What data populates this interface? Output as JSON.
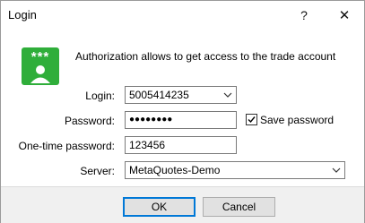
{
  "window": {
    "title": "Login",
    "help_glyph": "?",
    "close_glyph": "✕"
  },
  "header": {
    "icon_stars": "***",
    "message": "Authorization allows to get access to the trade account"
  },
  "form": {
    "login_label": "Login:",
    "login_value": "5005414235",
    "password_label": "Password:",
    "password_value": "●●●●●●●●",
    "save_password_label": "Save password",
    "save_password_checked": true,
    "otp_label": "One-time password:",
    "otp_value": "123456",
    "server_label": "Server:",
    "server_value": "MetaQuotes-Demo"
  },
  "buttons": {
    "ok": "OK",
    "cancel": "Cancel"
  }
}
